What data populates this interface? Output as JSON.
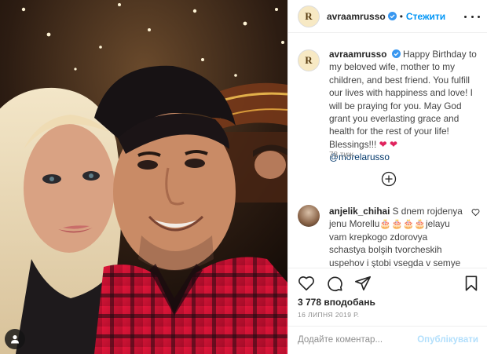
{
  "post": {
    "username": "avraamrusso",
    "avatar_monogram": "R",
    "follow_label": "Стежити",
    "separator": "•",
    "caption_text": "Happy Birthday to my beloved wife, mother to my children, and best friend. You fulfill our lives with happiness and love! I will be praying for you. May God grant you everlasting grace and health for the rest of your life! Blessings!!!",
    "caption_hearts": "❤ ❤",
    "caption_mention": "@morelarusso",
    "age": "78 тиж."
  },
  "comments": [
    {
      "username": "anjelik_chihai",
      "text": "S dnem rojdenya jenu Morellu🎂🎂🎂🎂jelayu vam krepkogo zdorovya schastya bolşih tvorcheskih uspehov i ştobi vsegda v semye bil mir..solntse i vzaimoponimanie...ne davaite"
    }
  ],
  "stats": {
    "likes": "3 778 вподобань",
    "date": "16 ЛИПНЯ 2019 Р."
  },
  "comment_box": {
    "placeholder": "Додайте коментар...",
    "publish_label": "Опублікувати"
  },
  "icons": [
    "heart-icon",
    "comment-icon",
    "share-icon",
    "bookmark-icon",
    "add-circle-icon",
    "tag-person-icon",
    "verified-badge-icon",
    "more-options-icon"
  ],
  "colors": {
    "link_blue": "#0095f6",
    "publish_disabled": "#b2dffc",
    "mention": "#00376b",
    "heart": "#e0245e",
    "muted": "#8e8e8e",
    "border": "#efefef"
  }
}
